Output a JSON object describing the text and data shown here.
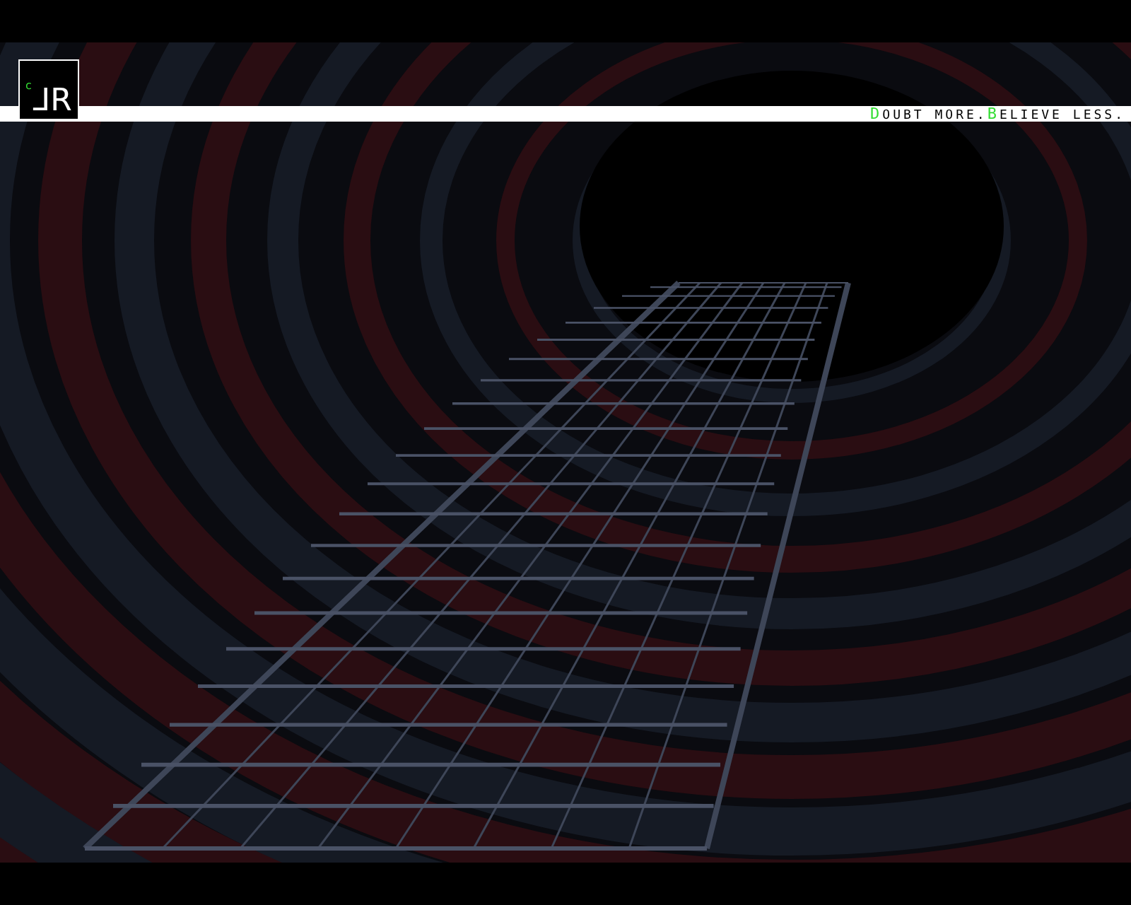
{
  "logo": {
    "mark": "c",
    "letters": "⅃R"
  },
  "tagline": [
    {
      "text": "D",
      "accent": true
    },
    {
      "text": "OUBT MORE.",
      "accent": false
    },
    {
      "text": "B",
      "accent": true
    },
    {
      "text": "ELIEVE LESS.",
      "accent": false
    }
  ]
}
